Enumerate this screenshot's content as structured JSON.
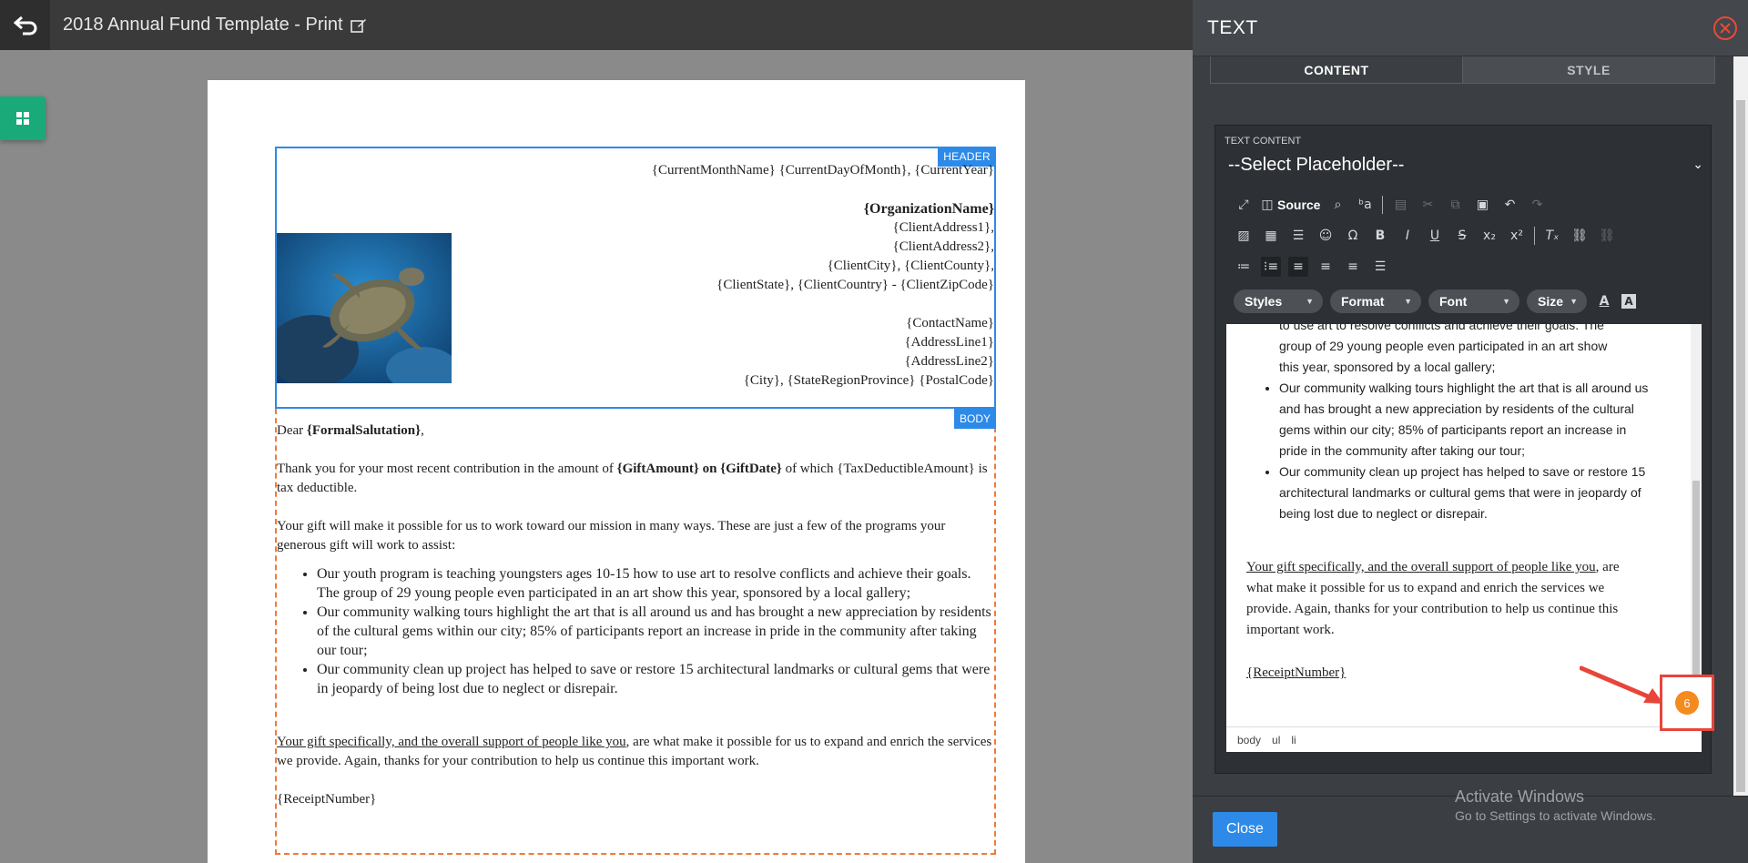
{
  "topbar": {
    "title": "2018 Annual Fund Template - Print"
  },
  "page": {
    "header_tag": "HEADER",
    "body_tag": "BODY",
    "header_lines": [
      "{CurrentMonthName} {CurrentDayOfMonth}, {CurrentYear}",
      "{OrganizationName}",
      "{ClientAddress1},",
      "{ClientAddress2},",
      "{ClientCity}, {ClientCounty},",
      "{ClientState}, {ClientCountry} - {ClientZipCode}",
      "{ContactName}",
      "{AddressLine1}",
      "{AddressLine2}",
      "{City}, {StateRegionProvince} {PostalCode}"
    ],
    "salutation_prefix": "Dear ",
    "salutation_name": "{FormalSalutation}",
    "salutation_suffix": ",",
    "para1_a": "Thank you for your most recent contribution in the amount of ",
    "para1_b": "{GiftAmount} on {GiftDate}",
    "para1_c": " of which {TaxDeductibleAmount} is tax deductible.",
    "para2": "Your gift will make it possible for us to work toward our mission in many ways. These are just a few of the programs your generous gift will work to assist:",
    "bullets": [
      "Our youth program is teaching youngsters ages 10-15 how to use art to resolve conflicts and achieve their goals. The group of 29 young people even participated in an art show this year, sponsored by a local gallery;",
      "Our community walking tours highlight the art that is all around us and has brought a new appreciation by residents of the cultural gems within our city; 85% of participants report an increase in pride in the community after taking our tour;",
      "Our community clean up project has helped to save or restore 15 architectural landmarks or cultural gems that were in jeopardy of being lost due to neglect or disrepair."
    ],
    "para3_underlined": "Your gift specifically, and the overall support of people like you",
    "para3_rest": ", are what make it possible for us to expand and enrich the services we provide. Again, thanks for your contribution to help us continue this important work.",
    "receipt": "{ReceiptNumber}"
  },
  "panel": {
    "title": "TEXT",
    "tabs": [
      "CONTENT",
      "STYLE"
    ],
    "text_content_label": "TEXT CONTENT",
    "placeholder_select": "--Select Placeholder--",
    "source_label": "Source",
    "combos": [
      "Styles",
      "Format",
      "Font",
      "Size"
    ],
    "editor": {
      "top_fragment_1": "to use art to resolve conflicts and achieve their goals. The",
      "top_fragment_2": "group of 29 young people even participated in an art show",
      "top_fragment_3": "this year, sponsored by a local gallery;",
      "bullet_2": "Our community walking tours highlight the art that is all around us and has brought a new appreciation by residents of the cultural gems within our city; 85% of participants report an increase in pride in the community after taking our tour;",
      "bullet_3": "Our community clean up project has helped to save or restore 15 architectural landmarks or cultural gems that were in jeopardy of being lost due to neglect or disrepair.",
      "para_underlined": "Your gift specifically, and the overall support of people like you",
      "para_rest": ", are what make it possible for us to expand and enrich the services we provide. Again, thanks for your contribution to help us continue this important work.",
      "receipt": "{ReceiptNumber}"
    },
    "status_path": [
      "body",
      "ul",
      "li"
    ],
    "badge_count": "6",
    "close_label": "Close",
    "watermark_line1": "Activate Windows",
    "watermark_line2": "Go to Settings to activate Windows."
  },
  "colors": {
    "accent": "#2d8ae8",
    "body_border": "#f07a3a",
    "badge": "#f58a1f",
    "highlight": "#e8453a",
    "side_tab": "#1aaa7a"
  }
}
